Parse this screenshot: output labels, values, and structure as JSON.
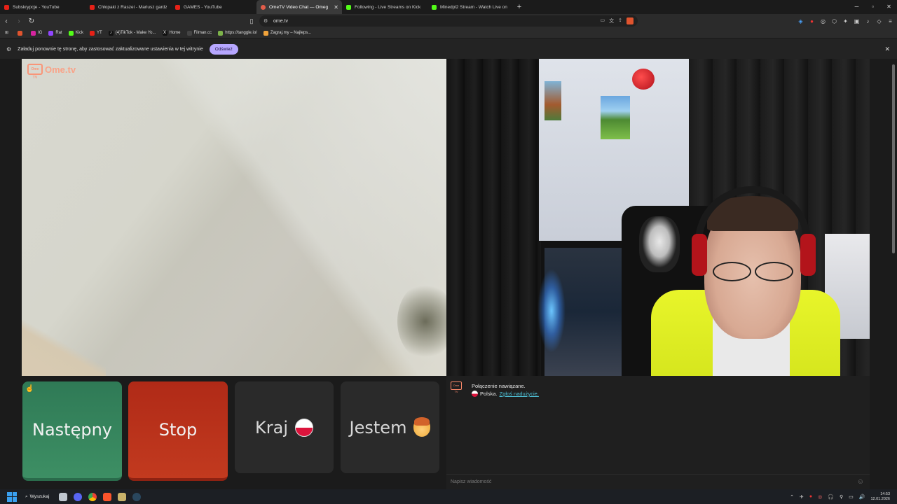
{
  "browser": {
    "tabs": [
      {
        "title": "Subskrypcje - YouTube",
        "favicon": "youtube-icon",
        "active": false
      },
      {
        "title": "Chłopaki z Raszei - Mariusz gardzi p",
        "favicon": "youtube-icon",
        "active": false
      },
      {
        "title": "GAMES - YouTube",
        "favicon": "youtube-icon",
        "active": false
      },
      {
        "title": "OmeTV Video Chat — Omeg",
        "favicon": "ometv-icon",
        "active": true
      },
      {
        "title": "Following - Live Streams on Kick",
        "favicon": "kick-icon",
        "active": false
      },
      {
        "title": "Minedpl2 Stream - Watch Live on",
        "favicon": "kick-icon",
        "active": false
      }
    ],
    "new_tab": "+",
    "window_controls": {
      "minimize": "─",
      "maximize": "▫",
      "close": "✕"
    },
    "url": "ome.tv",
    "bookmarks": [
      {
        "label": "",
        "icon": "folder-icon",
        "color": "#e0542e"
      },
      {
        "label": "IG",
        "icon": "instagram-icon",
        "color": "#d6249f"
      },
      {
        "label": "Rat",
        "icon": "twitch-icon",
        "color": "#9146ff"
      },
      {
        "label": "Kick",
        "icon": "kick-icon",
        "color": "#53fc18"
      },
      {
        "label": "YT",
        "icon": "youtube-icon",
        "color": "#e62117"
      },
      {
        "label": "(4)TikTok - Make Yo...",
        "icon": "tiktok-icon",
        "color": "#111111"
      },
      {
        "label": "Home",
        "icon": "x-icon",
        "color": "#111111"
      },
      {
        "label": "Filman.cc",
        "icon": "film-icon",
        "color": "#444444"
      },
      {
        "label": "https://tanggle.io/",
        "icon": "puzzle-icon",
        "color": "#7db34a"
      },
      {
        "label": "Zagraj.my – Najleps...",
        "icon": "person-icon",
        "color": "#f1a33b"
      }
    ]
  },
  "infobar": {
    "message": "Załaduj ponownie tę stronę, aby zastosować zaktualizowane ustawienia w tej witrynie",
    "refresh_label": "Odśwież"
  },
  "page": {
    "logo_text": "Ome.tv",
    "logo_box": "Ome TV",
    "buttons": {
      "next": "Następny",
      "stop": "Stop",
      "country": "Kraj",
      "gender": "Jestem"
    },
    "chat": {
      "logo_box": "Ome TV",
      "status": "Połączenie nawiązane.",
      "country": "Polska.",
      "report_link": "Zgłoś nadużycie.",
      "input_placeholder": "Napisz wiadomość"
    }
  },
  "taskbar": {
    "search_label": "Wyszukaj",
    "time": "14:53",
    "date": "12.01.2026"
  }
}
